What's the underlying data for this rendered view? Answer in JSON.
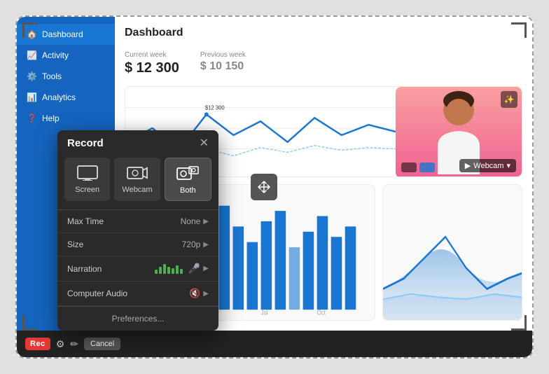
{
  "window": {
    "title": "Dashboard"
  },
  "sidebar": {
    "items": [
      {
        "label": "Dashboard",
        "icon": "🏠",
        "active": true
      },
      {
        "label": "Activity",
        "icon": "📈",
        "active": false
      },
      {
        "label": "Tools",
        "icon": "⚙️",
        "active": false
      },
      {
        "label": "Analytics",
        "icon": "📊",
        "active": false
      },
      {
        "label": "Help",
        "icon": "❓",
        "active": false
      }
    ]
  },
  "stats": {
    "current_week_label": "Current week",
    "current_value": "$ 12 300",
    "prev_week_label": "Previous week",
    "prev_value": "$ 10 150"
  },
  "webcam": {
    "label": "Webcam",
    "dropdown_arrow": "▾"
  },
  "record_panel": {
    "title": "Record",
    "close": "✕",
    "modes": [
      {
        "id": "screen",
        "label": "Screen",
        "active": false
      },
      {
        "id": "webcam",
        "label": "Webcam",
        "active": false
      },
      {
        "id": "both",
        "label": "Both",
        "active": true
      }
    ],
    "settings": [
      {
        "label": "Max Time",
        "value": "None"
      },
      {
        "label": "Size",
        "value": "720p"
      },
      {
        "label": "Narration",
        "value": ""
      },
      {
        "label": "Computer Audio",
        "value": ""
      }
    ],
    "preferences_label": "Preferences..."
  },
  "toolbar": {
    "rec_label": "Rec",
    "cancel_label": "Cancel"
  }
}
